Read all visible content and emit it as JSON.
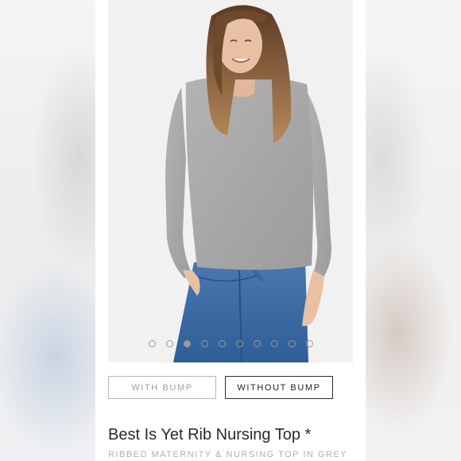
{
  "product": {
    "title": "Best Is Yet Rib Nursing Top *",
    "subtitle": "RIBBED MATERNITY & NURSING TOP IN GREY"
  },
  "carousel": {
    "image_alt": "Model wearing grey rib nursing top with blue jeans",
    "dot_count": 10,
    "active_index": 2
  },
  "options": {
    "with_bump": "WITH BUMP",
    "without_bump": "WITHOUT BUMP",
    "selected": "without_bump"
  },
  "colors": {
    "top_grey": "#a9a9a9",
    "denim": "#3e6ea8",
    "hair": "#7a5436",
    "skin": "#e8c1a4"
  }
}
